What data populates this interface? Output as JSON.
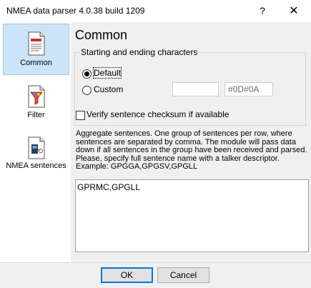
{
  "window": {
    "title": "NMEA data parser 4.0.38 build 1209",
    "help_glyph": "?",
    "close_glyph": "✕"
  },
  "sidebar": {
    "items": [
      {
        "label": "Common",
        "icon": "document-icon",
        "selected": true
      },
      {
        "label": "Filter",
        "icon": "filter-icon",
        "selected": false
      },
      {
        "label": "NMEA sentences",
        "icon": "nmea-sentences-icon",
        "selected": false
      }
    ]
  },
  "main": {
    "title": "Common",
    "group_label": "Starting and ending characters",
    "default_option": "Default",
    "custom_option": "Custom",
    "custom_start_value": "",
    "custom_end_value": "#0D#0A",
    "verify_checksum_label": "Verify sentence checksum if available",
    "verify_checksum_checked": false,
    "aggregate_description": "Aggregate sentences. One group of sentences per row, where sentences are separated by comma. The module will pass data down if all sentences in the group have been received and parsed. Please, specify full sentence name with a talker descriptor. Example: GPGGA,GPGSV,GPGLL",
    "aggregate_value": "GPRMC,GPGLL"
  },
  "footer": {
    "ok_label": "OK",
    "cancel_label": "Cancel"
  },
  "colors": {
    "selected_bg": "#cce4f7",
    "panel_bg": "#f0f0f0",
    "accent": "#0078d7"
  }
}
